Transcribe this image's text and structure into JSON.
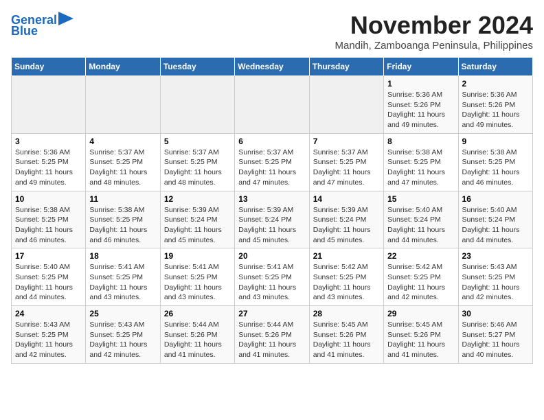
{
  "header": {
    "logo_line1": "General",
    "logo_line2": "Blue",
    "title": "November 2024",
    "subtitle": "Mandih, Zamboanga Peninsula, Philippines"
  },
  "days_of_week": [
    "Sunday",
    "Monday",
    "Tuesday",
    "Wednesday",
    "Thursday",
    "Friday",
    "Saturday"
  ],
  "weeks": [
    [
      {
        "day": "",
        "info": ""
      },
      {
        "day": "",
        "info": ""
      },
      {
        "day": "",
        "info": ""
      },
      {
        "day": "",
        "info": ""
      },
      {
        "day": "",
        "info": ""
      },
      {
        "day": "1",
        "info": "Sunrise: 5:36 AM\nSunset: 5:26 PM\nDaylight: 11 hours and 49 minutes."
      },
      {
        "day": "2",
        "info": "Sunrise: 5:36 AM\nSunset: 5:26 PM\nDaylight: 11 hours and 49 minutes."
      }
    ],
    [
      {
        "day": "3",
        "info": "Sunrise: 5:36 AM\nSunset: 5:25 PM\nDaylight: 11 hours and 49 minutes."
      },
      {
        "day": "4",
        "info": "Sunrise: 5:37 AM\nSunset: 5:25 PM\nDaylight: 11 hours and 48 minutes."
      },
      {
        "day": "5",
        "info": "Sunrise: 5:37 AM\nSunset: 5:25 PM\nDaylight: 11 hours and 48 minutes."
      },
      {
        "day": "6",
        "info": "Sunrise: 5:37 AM\nSunset: 5:25 PM\nDaylight: 11 hours and 47 minutes."
      },
      {
        "day": "7",
        "info": "Sunrise: 5:37 AM\nSunset: 5:25 PM\nDaylight: 11 hours and 47 minutes."
      },
      {
        "day": "8",
        "info": "Sunrise: 5:38 AM\nSunset: 5:25 PM\nDaylight: 11 hours and 47 minutes."
      },
      {
        "day": "9",
        "info": "Sunrise: 5:38 AM\nSunset: 5:25 PM\nDaylight: 11 hours and 46 minutes."
      }
    ],
    [
      {
        "day": "10",
        "info": "Sunrise: 5:38 AM\nSunset: 5:25 PM\nDaylight: 11 hours and 46 minutes."
      },
      {
        "day": "11",
        "info": "Sunrise: 5:38 AM\nSunset: 5:25 PM\nDaylight: 11 hours and 46 minutes."
      },
      {
        "day": "12",
        "info": "Sunrise: 5:39 AM\nSunset: 5:24 PM\nDaylight: 11 hours and 45 minutes."
      },
      {
        "day": "13",
        "info": "Sunrise: 5:39 AM\nSunset: 5:24 PM\nDaylight: 11 hours and 45 minutes."
      },
      {
        "day": "14",
        "info": "Sunrise: 5:39 AM\nSunset: 5:24 PM\nDaylight: 11 hours and 45 minutes."
      },
      {
        "day": "15",
        "info": "Sunrise: 5:40 AM\nSunset: 5:24 PM\nDaylight: 11 hours and 44 minutes."
      },
      {
        "day": "16",
        "info": "Sunrise: 5:40 AM\nSunset: 5:24 PM\nDaylight: 11 hours and 44 minutes."
      }
    ],
    [
      {
        "day": "17",
        "info": "Sunrise: 5:40 AM\nSunset: 5:25 PM\nDaylight: 11 hours and 44 minutes."
      },
      {
        "day": "18",
        "info": "Sunrise: 5:41 AM\nSunset: 5:25 PM\nDaylight: 11 hours and 43 minutes."
      },
      {
        "day": "19",
        "info": "Sunrise: 5:41 AM\nSunset: 5:25 PM\nDaylight: 11 hours and 43 minutes."
      },
      {
        "day": "20",
        "info": "Sunrise: 5:41 AM\nSunset: 5:25 PM\nDaylight: 11 hours and 43 minutes."
      },
      {
        "day": "21",
        "info": "Sunrise: 5:42 AM\nSunset: 5:25 PM\nDaylight: 11 hours and 43 minutes."
      },
      {
        "day": "22",
        "info": "Sunrise: 5:42 AM\nSunset: 5:25 PM\nDaylight: 11 hours and 42 minutes."
      },
      {
        "day": "23",
        "info": "Sunrise: 5:43 AM\nSunset: 5:25 PM\nDaylight: 11 hours and 42 minutes."
      }
    ],
    [
      {
        "day": "24",
        "info": "Sunrise: 5:43 AM\nSunset: 5:25 PM\nDaylight: 11 hours and 42 minutes."
      },
      {
        "day": "25",
        "info": "Sunrise: 5:43 AM\nSunset: 5:25 PM\nDaylight: 11 hours and 42 minutes."
      },
      {
        "day": "26",
        "info": "Sunrise: 5:44 AM\nSunset: 5:26 PM\nDaylight: 11 hours and 41 minutes."
      },
      {
        "day": "27",
        "info": "Sunrise: 5:44 AM\nSunset: 5:26 PM\nDaylight: 11 hours and 41 minutes."
      },
      {
        "day": "28",
        "info": "Sunrise: 5:45 AM\nSunset: 5:26 PM\nDaylight: 11 hours and 41 minutes."
      },
      {
        "day": "29",
        "info": "Sunrise: 5:45 AM\nSunset: 5:26 PM\nDaylight: 11 hours and 41 minutes."
      },
      {
        "day": "30",
        "info": "Sunrise: 5:46 AM\nSunset: 5:27 PM\nDaylight: 11 hours and 40 minutes."
      }
    ]
  ]
}
